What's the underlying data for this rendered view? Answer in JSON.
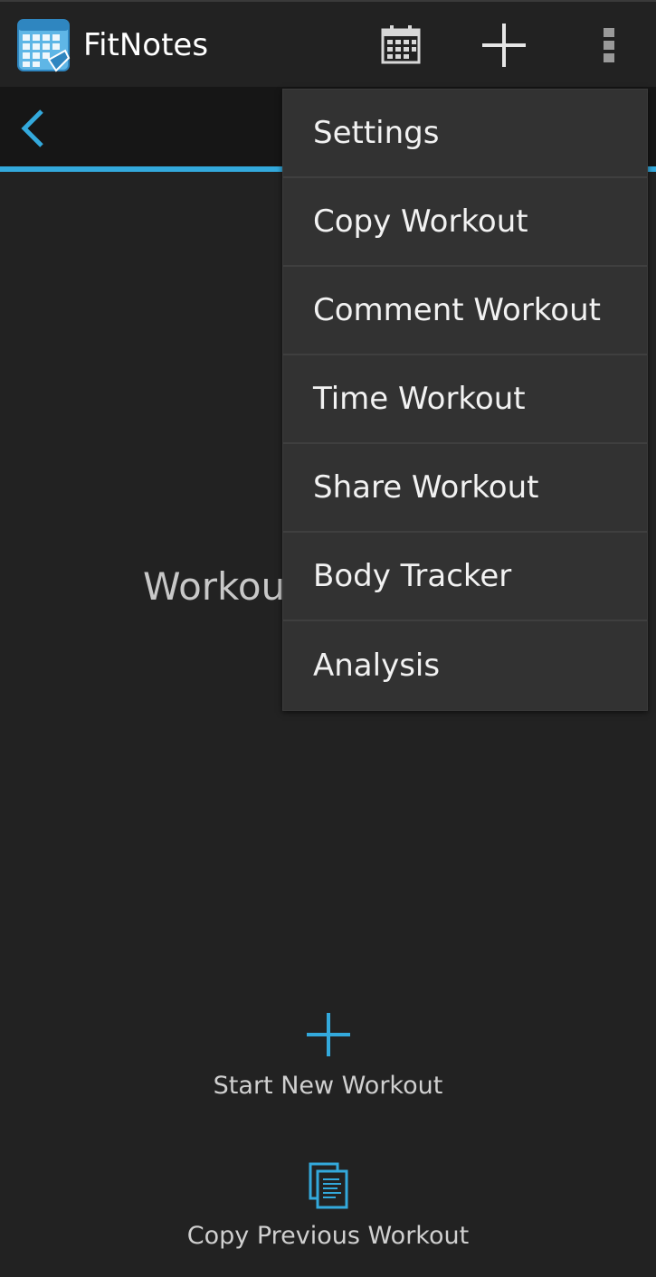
{
  "app": {
    "title": "FitNotes",
    "icon": "fitnotes-calendar-logo"
  },
  "action_bar": {
    "calendar_icon": "calendar-icon",
    "add_icon": "plus-icon",
    "overflow_icon": "overflow-menu-icon"
  },
  "date_bar": {
    "prev_icon": "chevron-left-icon"
  },
  "main": {
    "empty_message": "Workou"
  },
  "actions": {
    "start_new_workout": "Start New Workout",
    "copy_previous_workout": "Copy Previous Workout"
  },
  "menu": {
    "items": [
      {
        "label": "Settings"
      },
      {
        "label": "Copy Workout"
      },
      {
        "label": "Comment Workout"
      },
      {
        "label": "Time Workout"
      },
      {
        "label": "Share Workout"
      },
      {
        "label": "Body Tracker"
      },
      {
        "label": "Analysis"
      }
    ]
  },
  "colors": {
    "accent": "#33a9dc",
    "background": "#222222",
    "menu_background": "#323232"
  }
}
